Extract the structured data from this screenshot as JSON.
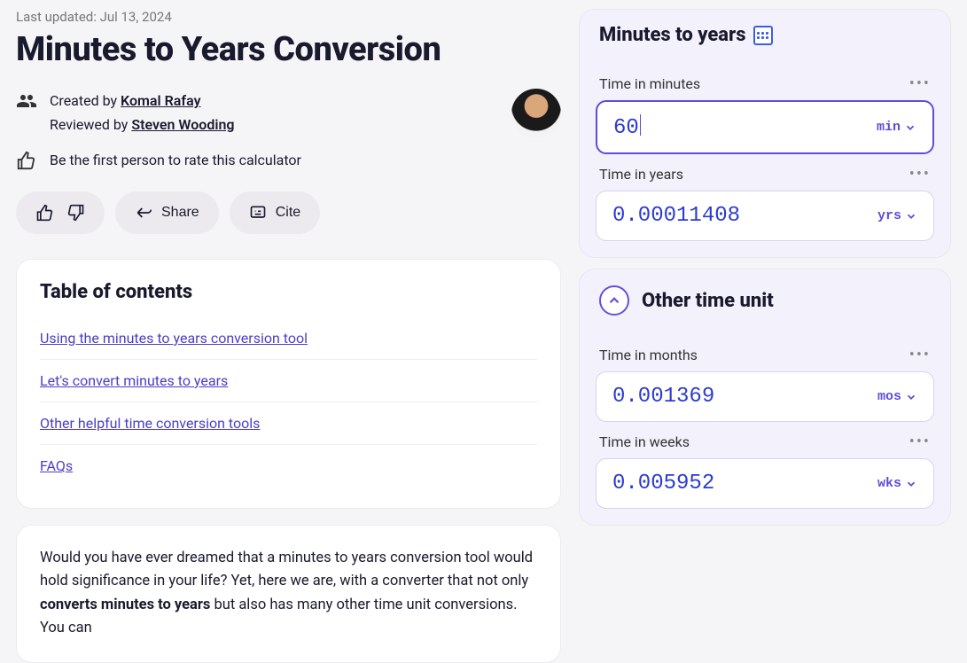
{
  "meta": {
    "last_updated": "Last updated: Jul 13, 2024",
    "title": "Minutes to Years Conversion"
  },
  "byline": {
    "created_prefix": "Created by ",
    "author": "Komal Rafay",
    "reviewed_prefix": "Reviewed by ",
    "reviewer": "Steven Wooding",
    "rate_prompt": "Be the first person to rate this calculator"
  },
  "actions": {
    "share": "Share",
    "cite": "Cite"
  },
  "toc": {
    "title": "Table of contents",
    "items": [
      "Using the minutes to years conversion tool",
      "Let's convert minutes to years",
      "Other helpful time conversion tools",
      "FAQs"
    ]
  },
  "article": {
    "p1a": "Would you have ever dreamed that a minutes to years conversion tool would hold significance in your life? Yet, here we are, with a converter that not only ",
    "p1b": "converts minutes to years",
    "p1c": " but also has many other time unit conversions. You can"
  },
  "calc": {
    "main_title": "Minutes to years",
    "fields": [
      {
        "label": "Time in minutes",
        "value": "60",
        "unit": "min",
        "active": true
      },
      {
        "label": "Time in years",
        "value": "0.00011408",
        "unit": "yrs",
        "active": false
      }
    ],
    "other": {
      "title": "Other time unit",
      "fields": [
        {
          "label": "Time in months",
          "value": "0.001369",
          "unit": "mos"
        },
        {
          "label": "Time in weeks",
          "value": "0.005952",
          "unit": "wks"
        }
      ]
    }
  }
}
